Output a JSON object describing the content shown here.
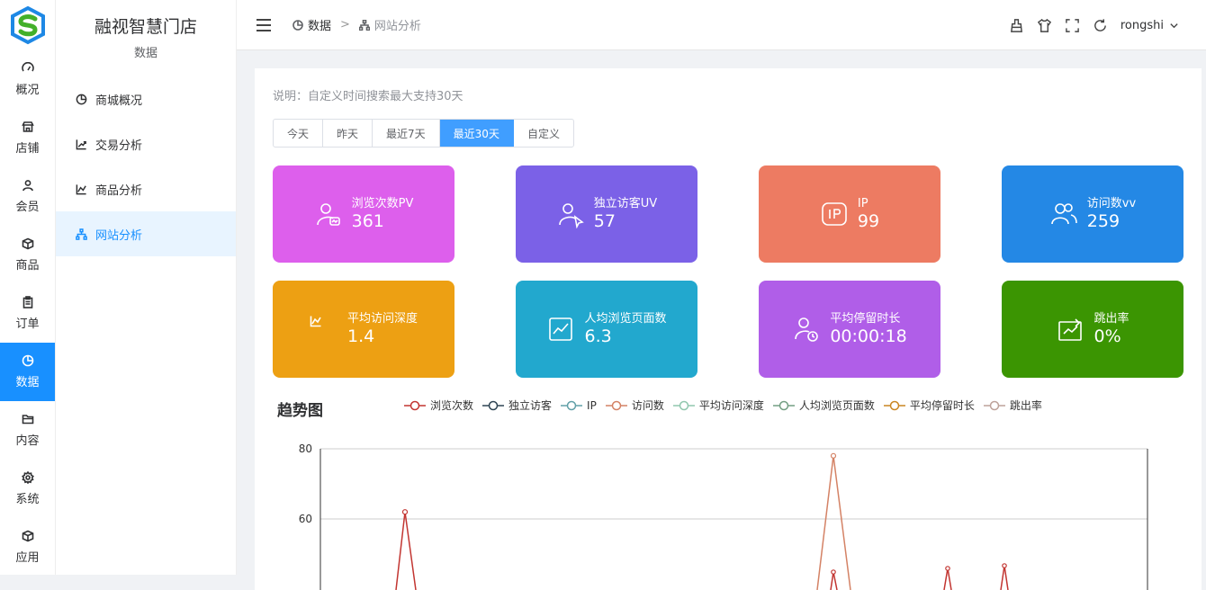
{
  "brand": {
    "store_name": "融视智慧门店",
    "section": "数据"
  },
  "rail": [
    {
      "label": "概况",
      "icon": "dashboard-icon"
    },
    {
      "label": "店铺",
      "icon": "shop-icon"
    },
    {
      "label": "会员",
      "icon": "user-icon"
    },
    {
      "label": "商品",
      "icon": "box-icon"
    },
    {
      "label": "订单",
      "icon": "clipboard-icon"
    },
    {
      "label": "数据",
      "icon": "pie-chart-icon",
      "active": true
    },
    {
      "label": "内容",
      "icon": "folder-icon"
    },
    {
      "label": "系统",
      "icon": "gear-icon"
    },
    {
      "label": "应用",
      "icon": "cube-icon"
    }
  ],
  "subnav": [
    {
      "label": "商城概况",
      "icon": "pie-chart-icon"
    },
    {
      "label": "交易分析",
      "icon": "trend-up-icon"
    },
    {
      "label": "商品分析",
      "icon": "line-chart-icon"
    },
    {
      "label": "网站分析",
      "icon": "sitemap-icon",
      "active": true
    }
  ],
  "breadcrumb": {
    "first": "数据",
    "separator": ">",
    "second": "网站分析"
  },
  "user": {
    "name": "rongshi"
  },
  "note": "说明：自定义时间搜索最大支持30天",
  "ranges": [
    "今天",
    "昨天",
    "最近7天",
    "最近30天",
    "自定义"
  ],
  "active_range": "最近30天",
  "stats": [
    {
      "label": "浏览次数PV",
      "value": "361",
      "color": "#dd5fec",
      "icon": "user-card-icon"
    },
    {
      "label": "独立访客UV",
      "value": "57",
      "color": "#7b61e7",
      "icon": "user-click-icon"
    },
    {
      "label": "IP",
      "value": "99",
      "color": "#ed7b62",
      "icon": "ip-icon"
    },
    {
      "label": "访问数vv",
      "value": "259",
      "color": "#2488e5",
      "icon": "users-icon"
    },
    {
      "label": "平均访问深度",
      "value": "1.4",
      "color": "#eda013",
      "icon": "line-chart-icon"
    },
    {
      "label": "人均浏览页面数",
      "value": "6.3",
      "color": "#22a8ce",
      "icon": "document-chart-icon"
    },
    {
      "label": "平均停留时长",
      "value": "00:00:18",
      "color": "#b05ee8",
      "icon": "user-clock-icon"
    },
    {
      "label": "跳出率",
      "value": "0%",
      "color": "#3b9502",
      "icon": "exit-icon"
    }
  ],
  "chart_title": "趋势图",
  "chart_data": {
    "type": "line",
    "title": "趋势图",
    "ylim": [
      40,
      80
    ],
    "yticks": [
      80,
      60
    ],
    "grid": true,
    "legend": "top",
    "series": [
      {
        "name": "浏览次数",
        "color": "#c23531",
        "peak": 62
      },
      {
        "name": "独立访客",
        "color": "#2f4554"
      },
      {
        "name": "IP",
        "color": "#61a0a8"
      },
      {
        "name": "访问数",
        "color": "#d48265",
        "peak": 78
      },
      {
        "name": "平均访问深度",
        "color": "#91c7ae"
      },
      {
        "name": "人均浏览页面数",
        "color": "#749f83"
      },
      {
        "name": "平均停留时长",
        "color": "#ca8622"
      },
      {
        "name": "跳出率",
        "color": "#bda29a"
      }
    ]
  }
}
